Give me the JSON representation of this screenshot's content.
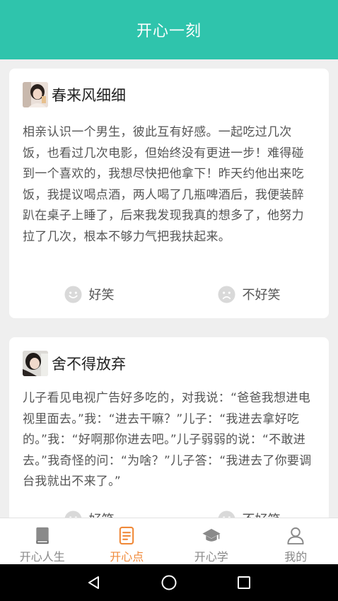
{
  "header": {
    "title": "开心一刻"
  },
  "posts": [
    {
      "author": "春来风细细",
      "text": "相亲认识一个男生，彼此互有好感。一起吃过几次饭，也看过几次电影，但始终没有更进一步！难得碰到一个喜欢的，我想尽快把他拿下！昨天约他出来吃饭，我提议喝点酒，两人喝了几瓶啤酒后，我便装醉趴在桌子上睡了，后来我发现我真的想多了，他努力拉了几次，根本不够力气把我扶起来。",
      "funny_label": "好笑",
      "not_funny_label": "不好笑"
    },
    {
      "author": "舍不得放弃",
      "text": "儿子看见电视广告好多吃的，对我说：“爸爸我想进电视里面去。”我：“进去干嘛？”儿子：“我进去拿好吃的。”我：“好啊那你进去吧。”儿子弱弱的说：“不敢进去。”我奇怪的问：“为啥？”儿子答：“我进去了你要调台我就出不来了。”",
      "funny_label": "好笑",
      "not_funny_label": "不好笑"
    }
  ],
  "tabs": [
    {
      "label": "开心人生",
      "icon": "book-icon"
    },
    {
      "label": "开心点",
      "icon": "document-icon"
    },
    {
      "label": "开心学",
      "icon": "graduation-cap-icon"
    },
    {
      "label": "我的",
      "icon": "person-icon"
    }
  ],
  "active_tab": "开心点",
  "colors": {
    "header": "#2fc4ac",
    "active_tab": "#f08a3a",
    "inactive_tab": "#888888"
  }
}
